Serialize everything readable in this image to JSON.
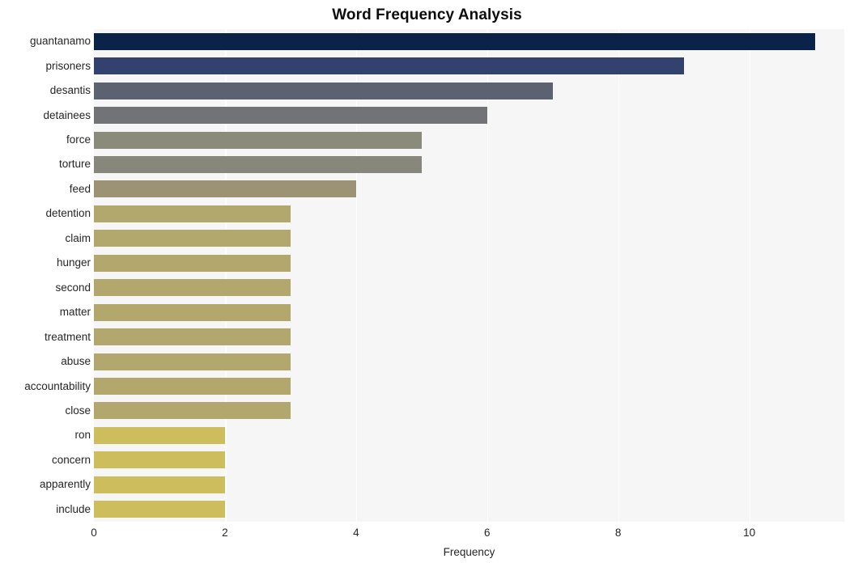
{
  "chart_data": {
    "type": "bar",
    "orientation": "horizontal",
    "title": "Word Frequency Analysis",
    "xlabel": "Frequency",
    "ylabel": "",
    "xlim": [
      0,
      11.45
    ],
    "xticks": [
      0,
      2,
      4,
      6,
      8,
      10
    ],
    "xtick_labels": [
      "0",
      "2",
      "4",
      "6",
      "8",
      "10"
    ],
    "grid": "vertical",
    "legend": "none",
    "categories": [
      "guantanamo",
      "prisoners",
      "desantis",
      "detainees",
      "force",
      "torture",
      "feed",
      "detention",
      "claim",
      "hunger",
      "second",
      "matter",
      "treatment",
      "abuse",
      "accountability",
      "close",
      "ron",
      "concern",
      "apparently",
      "include"
    ],
    "values": [
      11,
      9,
      7,
      6,
      5,
      5,
      4,
      3,
      3,
      3,
      3,
      3,
      3,
      3,
      3,
      3,
      2,
      2,
      2,
      2
    ],
    "bar_colors": [
      "#0a2348",
      "#32416e",
      "#5d6271",
      "#727376",
      "#8b8b7c",
      "#87877b",
      "#9c9374",
      "#b2a76c",
      "#b2a76c",
      "#b2a76c",
      "#b2a76c",
      "#b2a76c",
      "#b2a76c",
      "#b2a76c",
      "#b2a76c",
      "#b2a76c",
      "#cdbd5c",
      "#cdbd5c",
      "#cdbd5c",
      "#cdbd5c"
    ],
    "plot_background": "#f6f6f7",
    "gridline_color": "#ffffff",
    "text_color": "#262626",
    "title_color": "#0d0d0d"
  }
}
